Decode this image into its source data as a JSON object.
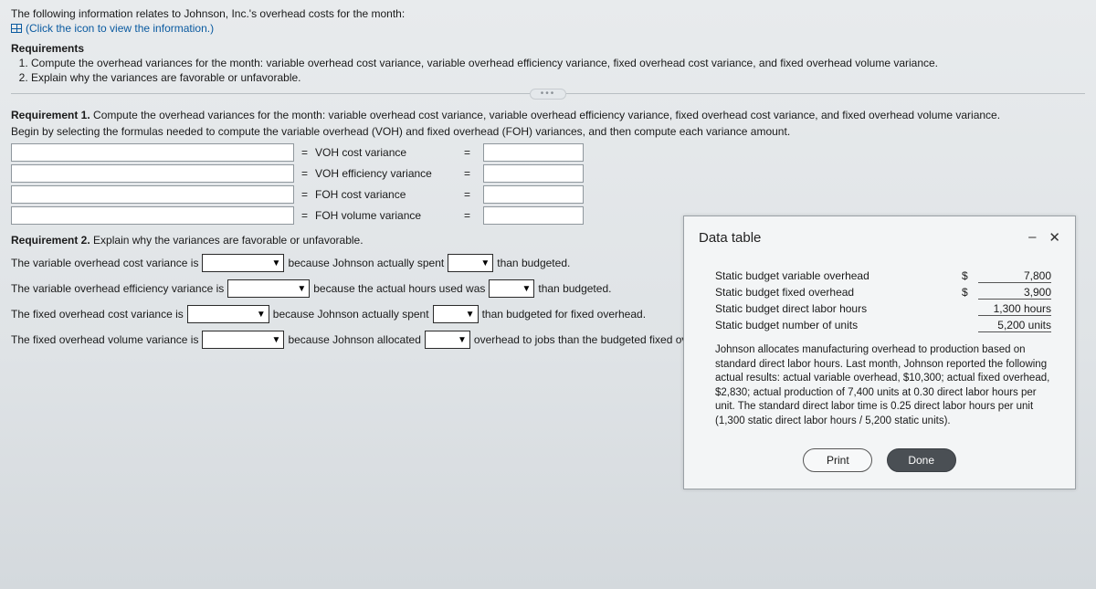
{
  "header": {
    "intro": "The following information relates to Johnson, Inc.'s overhead costs for the month:",
    "click_hint": "(Click the icon to view the information.)"
  },
  "requirements": {
    "heading": "Requirements",
    "items": [
      "Compute the overhead variances for the month: variable overhead cost variance, variable overhead efficiency variance, fixed overhead cost variance, and fixed overhead volume variance.",
      "Explain why the variances are favorable or unfavorable."
    ]
  },
  "req1": {
    "label": "Requirement 1.",
    "text": "Compute the overhead variances for the month: variable overhead cost variance, variable overhead efficiency variance, fixed overhead cost variance, and fixed overhead volume variance.",
    "sub": "Begin by selecting the formulas needed to compute the variable overhead (VOH) and fixed overhead (FOH) variances, and then compute each variance amount.",
    "formulas": [
      "VOH cost variance",
      "VOH efficiency variance",
      "FOH cost variance",
      "FOH volume variance"
    ]
  },
  "req2": {
    "label": "Requirement 2.",
    "text": "Explain why the variances are favorable or unfavorable.",
    "s1": {
      "pre": "The variable overhead cost variance is",
      "mid": "because Johnson actually spent",
      "post": "than budgeted."
    },
    "s2": {
      "pre": "The variable overhead efficiency variance is",
      "mid": "because the actual hours used was",
      "post": "than budgeted."
    },
    "s3": {
      "pre": "The fixed overhead cost variance is",
      "mid": "because Johnson actually spent",
      "post": "than budgeted for fixed overhead."
    },
    "s4": {
      "pre": "The fixed overhead volume variance is",
      "mid": "because Johnson allocated",
      "post": "overhead to jobs than the budgeted fixed overhead amount."
    }
  },
  "popup": {
    "title": "Data table",
    "minimize": "–",
    "close": "✕",
    "rows": [
      {
        "label": "Static budget variable overhead",
        "currency": "$",
        "value": "7,800"
      },
      {
        "label": "Static budget fixed overhead",
        "currency": "$",
        "value": "3,900"
      },
      {
        "label": "Static budget direct labor hours",
        "currency": "",
        "value": "1,300 hours"
      },
      {
        "label": "Static budget number of units",
        "currency": "",
        "value": "5,200 units"
      }
    ],
    "paragraph": "Johnson allocates manufacturing overhead to production based on standard direct labor hours. Last month, Johnson reported the following actual results: actual variable overhead, $10,300; actual fixed overhead, $2,830; actual production of 7,400 units at 0.30 direct labor hours per unit. The standard direct labor time is 0.25 direct labor hours per unit (1,300 static direct labor hours / 5,200 static units).",
    "print": "Print",
    "done": "Done"
  },
  "symbols": {
    "equals": "=",
    "caret": "▼"
  }
}
